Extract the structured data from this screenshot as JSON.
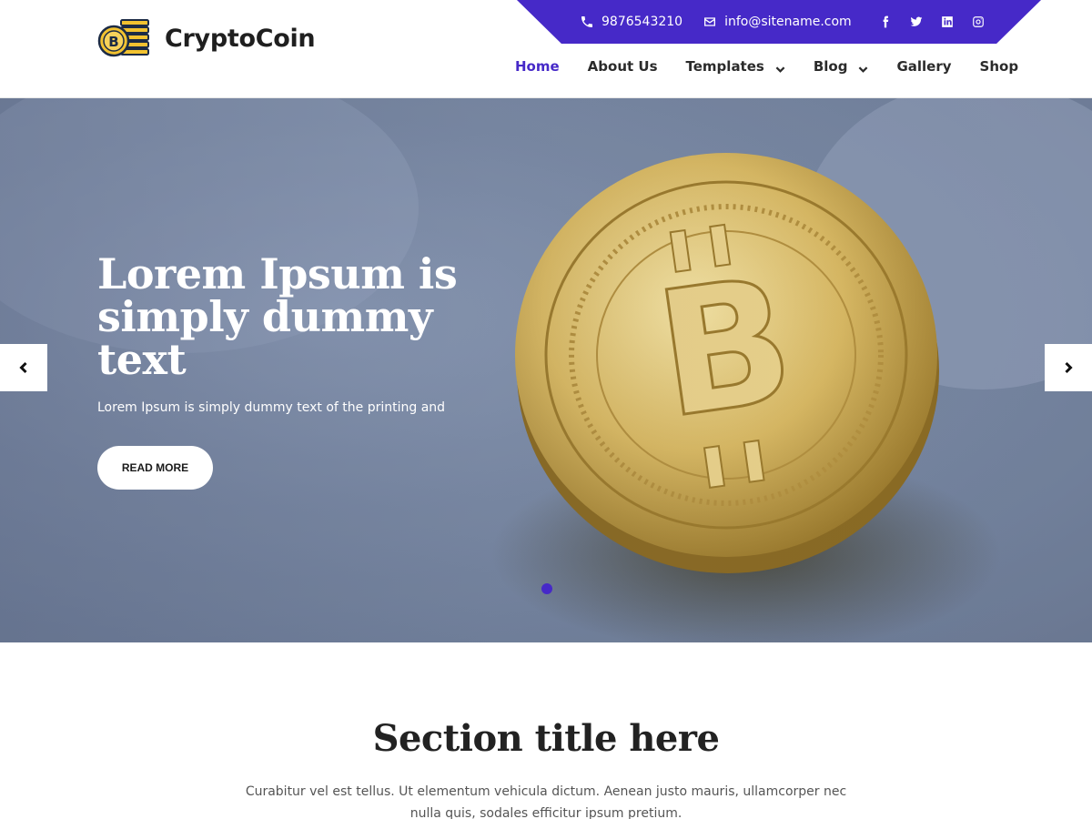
{
  "brand": {
    "name": "CryptoCoin"
  },
  "topbar": {
    "phone": "9876543210",
    "email": "info@sitename.com",
    "socials": [
      "facebook-icon",
      "twitter-icon",
      "linkedin-icon",
      "instagram-icon"
    ]
  },
  "nav": {
    "items": [
      {
        "label": "Home",
        "active": true,
        "dropdown": false
      },
      {
        "label": "About Us",
        "dropdown": false
      },
      {
        "label": "Templates",
        "dropdown": true
      },
      {
        "label": "Blog",
        "dropdown": true
      },
      {
        "label": "Gallery",
        "dropdown": false
      },
      {
        "label": "Shop",
        "dropdown": false
      }
    ]
  },
  "hero": {
    "title": "Lorem Ipsum is simply dummy text",
    "subtitle": "Lorem Ipsum is simply dummy text of the printing and",
    "button": "READ MORE"
  },
  "section": {
    "title": "Section title here",
    "text": "Curabitur vel est tellus. Ut elementum vehicula dictum. Aenean justo mauris, ullamcorper nec nulla quis, sodales efficitur ipsum pretium."
  },
  "colors": {
    "accent": "#4629c8",
    "coin": "#d6b45a"
  }
}
